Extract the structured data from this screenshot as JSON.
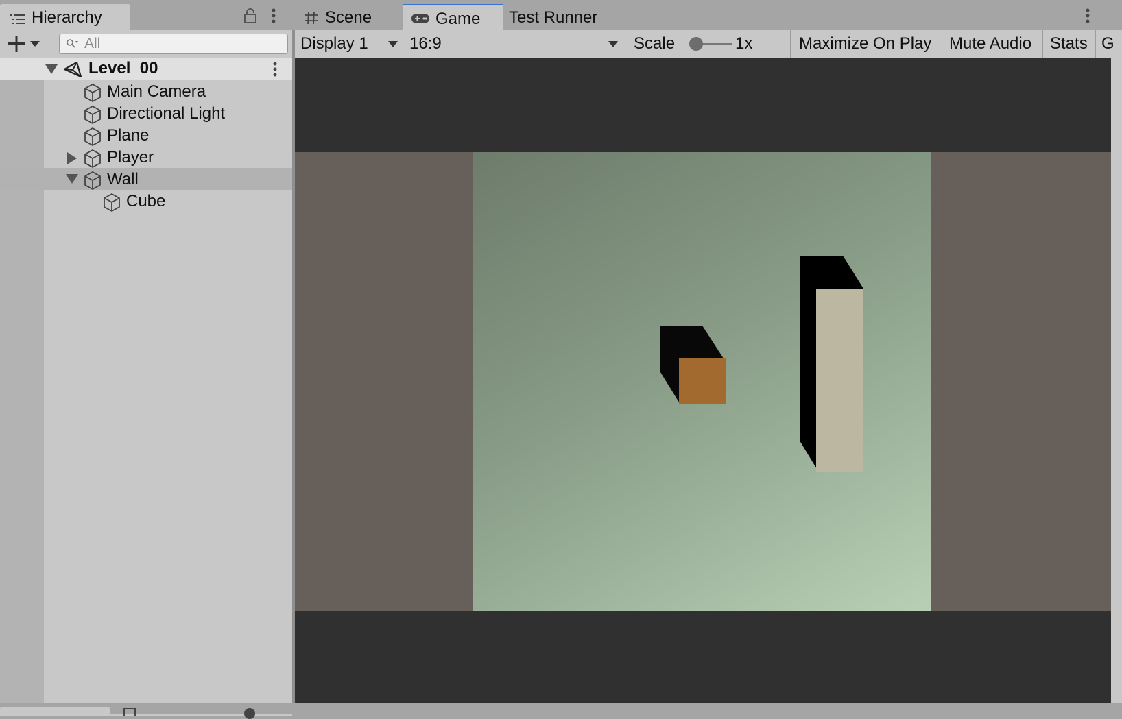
{
  "hierarchy": {
    "tab_label": "Hierarchy",
    "search_placeholder": "All",
    "scene_name": "Level_00",
    "items": [
      {
        "label": "Main Camera",
        "depth": 1,
        "expander": "none"
      },
      {
        "label": "Directional Light",
        "depth": 1,
        "expander": "none"
      },
      {
        "label": "Plane",
        "depth": 1,
        "expander": "none"
      },
      {
        "label": "Player",
        "depth": 1,
        "expander": "collapsed"
      },
      {
        "label": "Wall",
        "depth": 1,
        "expander": "expanded",
        "selected": true
      },
      {
        "label": "Cube",
        "depth": 2,
        "expander": "none"
      }
    ]
  },
  "tabs": {
    "scene": "Scene",
    "game": "Game",
    "test_runner": "Test Runner",
    "active": "game"
  },
  "game_toolbar": {
    "display": "Display 1",
    "aspect": "16:9",
    "scale_label": "Scale",
    "scale_value": "1x",
    "maximize": "Maximize On Play",
    "mute": "Mute Audio",
    "stats": "Stats",
    "gizmos_partial": "G"
  },
  "colors": {
    "accent": "#3a72d0",
    "player": "#a36a30",
    "wall": "#bcb7a0",
    "background": "#675f59",
    "letterbox": "#303030"
  }
}
